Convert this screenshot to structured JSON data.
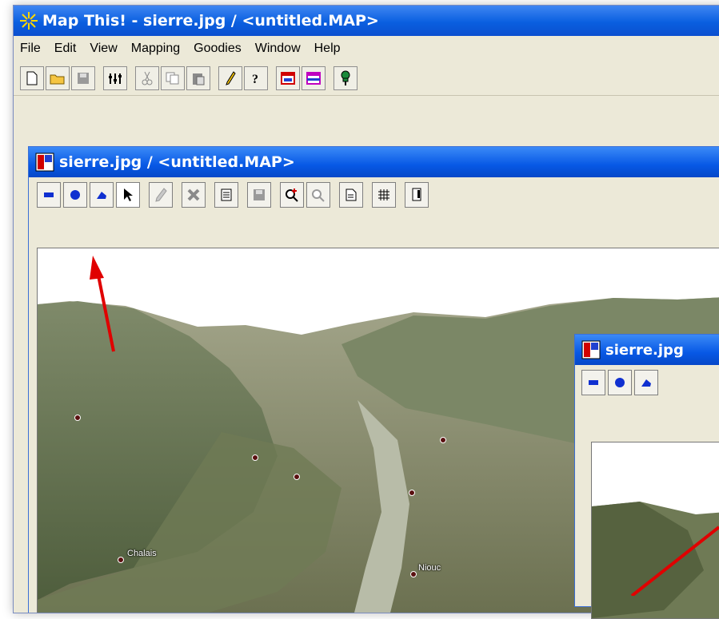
{
  "app": {
    "title": "Map This! - sierre.jpg / <untitled.MAP>",
    "menu": [
      "File",
      "Edit",
      "View",
      "Mapping",
      "Goodies",
      "Window",
      "Help"
    ]
  },
  "main_toolbar": {
    "icons": [
      "new-file-icon",
      "open-folder-icon",
      "save-disk-icon",
      "sliders-icon",
      "cut-scissors-icon",
      "copy-icon",
      "paste-icon",
      "pencil-icon",
      "help-question-icon",
      "red-window-icon",
      "magenta-window-icon",
      "pushpin-icon"
    ]
  },
  "child_window": {
    "title": "sierre.jpg / <untitled.MAP>",
    "toolbar_icons": [
      "rectangle-tool-icon",
      "circle-tool-icon",
      "polygon-tool-icon",
      "arrow-select-icon",
      "edit-pencil-icon",
      "delete-x-icon",
      "properties-icon",
      "save-icon",
      "zoom-in-icon",
      "zoom-out-icon",
      "document-icon",
      "grid-icon",
      "export-icon"
    ],
    "map_labels": [
      "Chalais",
      "Niouc"
    ]
  },
  "sub_window": {
    "title": "sierre.jpg"
  }
}
